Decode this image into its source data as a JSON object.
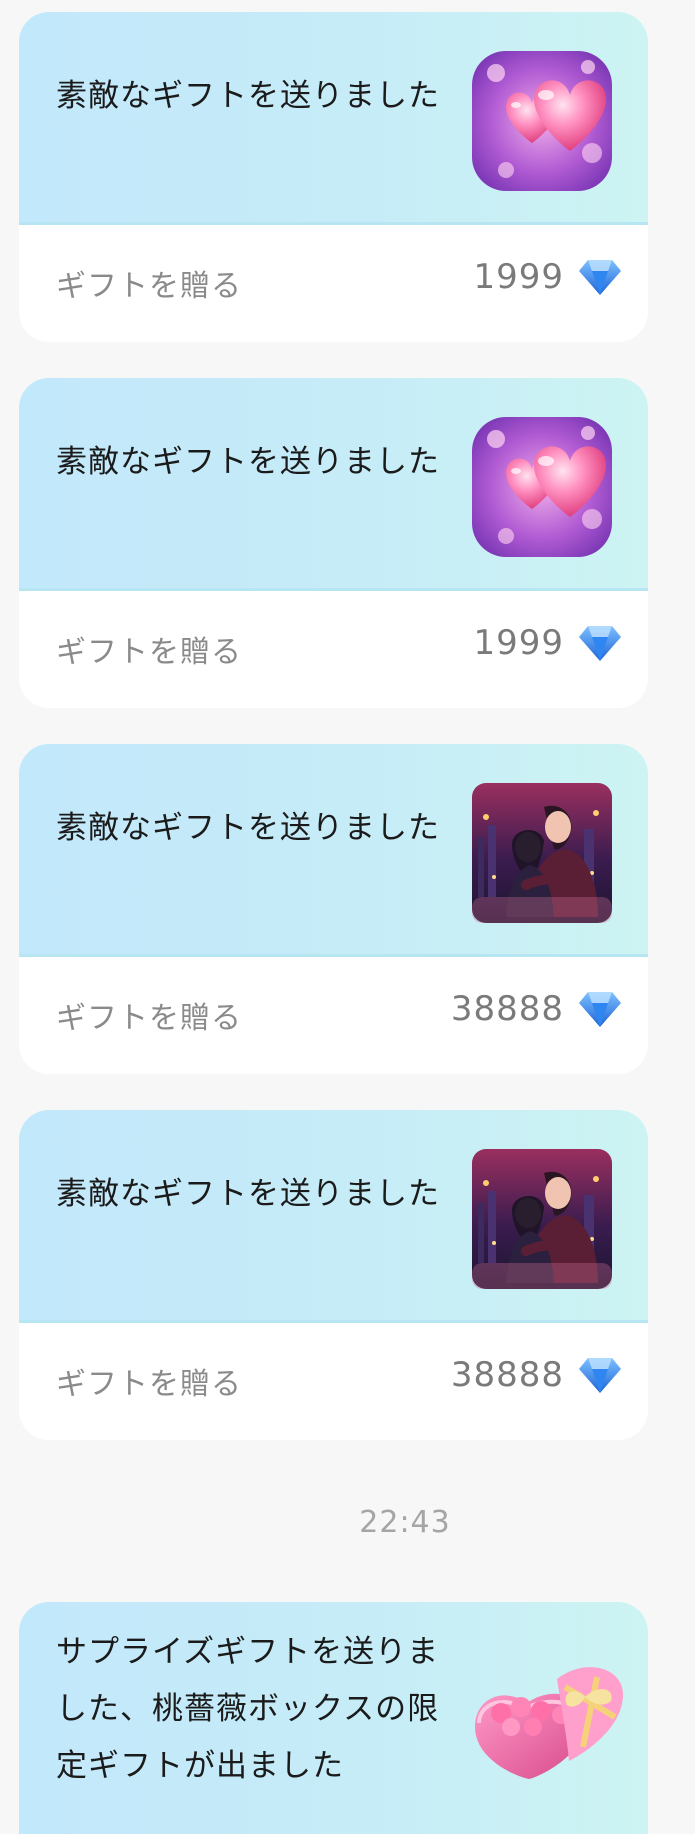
{
  "gift_cards": [
    {
      "message": "素敵なギフトを送りました",
      "action_label": "ギフトを贈る",
      "price": "1999",
      "gift_icon": "pink-hearts-gift-icon"
    },
    {
      "message": "素敵なギフトを送りました",
      "action_label": "ギフトを贈る",
      "price": "1999",
      "gift_icon": "pink-hearts-gift-icon"
    },
    {
      "message": "素敵なギフトを送りました",
      "action_label": "ギフトを贈る",
      "price": "38888",
      "gift_icon": "couple-embrace-gift-icon"
    },
    {
      "message": "素敵なギフトを送りました",
      "action_label": "ギフトを贈る",
      "price": "38888",
      "gift_icon": "couple-embrace-gift-icon"
    }
  ],
  "timestamp": "22:43",
  "surprise_card": {
    "message": "サプライズギフトを送りました、桃薔薇ボックスの限定ギフトが出ました",
    "gift_icon": "rose-heart-box-icon"
  },
  "currency_icon": "diamond-icon",
  "colors": {
    "card_gradient_start": "#c2e8fb",
    "card_gradient_end": "#cdf4f2",
    "diamond": "#2f86f0",
    "background": "#f7f7f8"
  }
}
